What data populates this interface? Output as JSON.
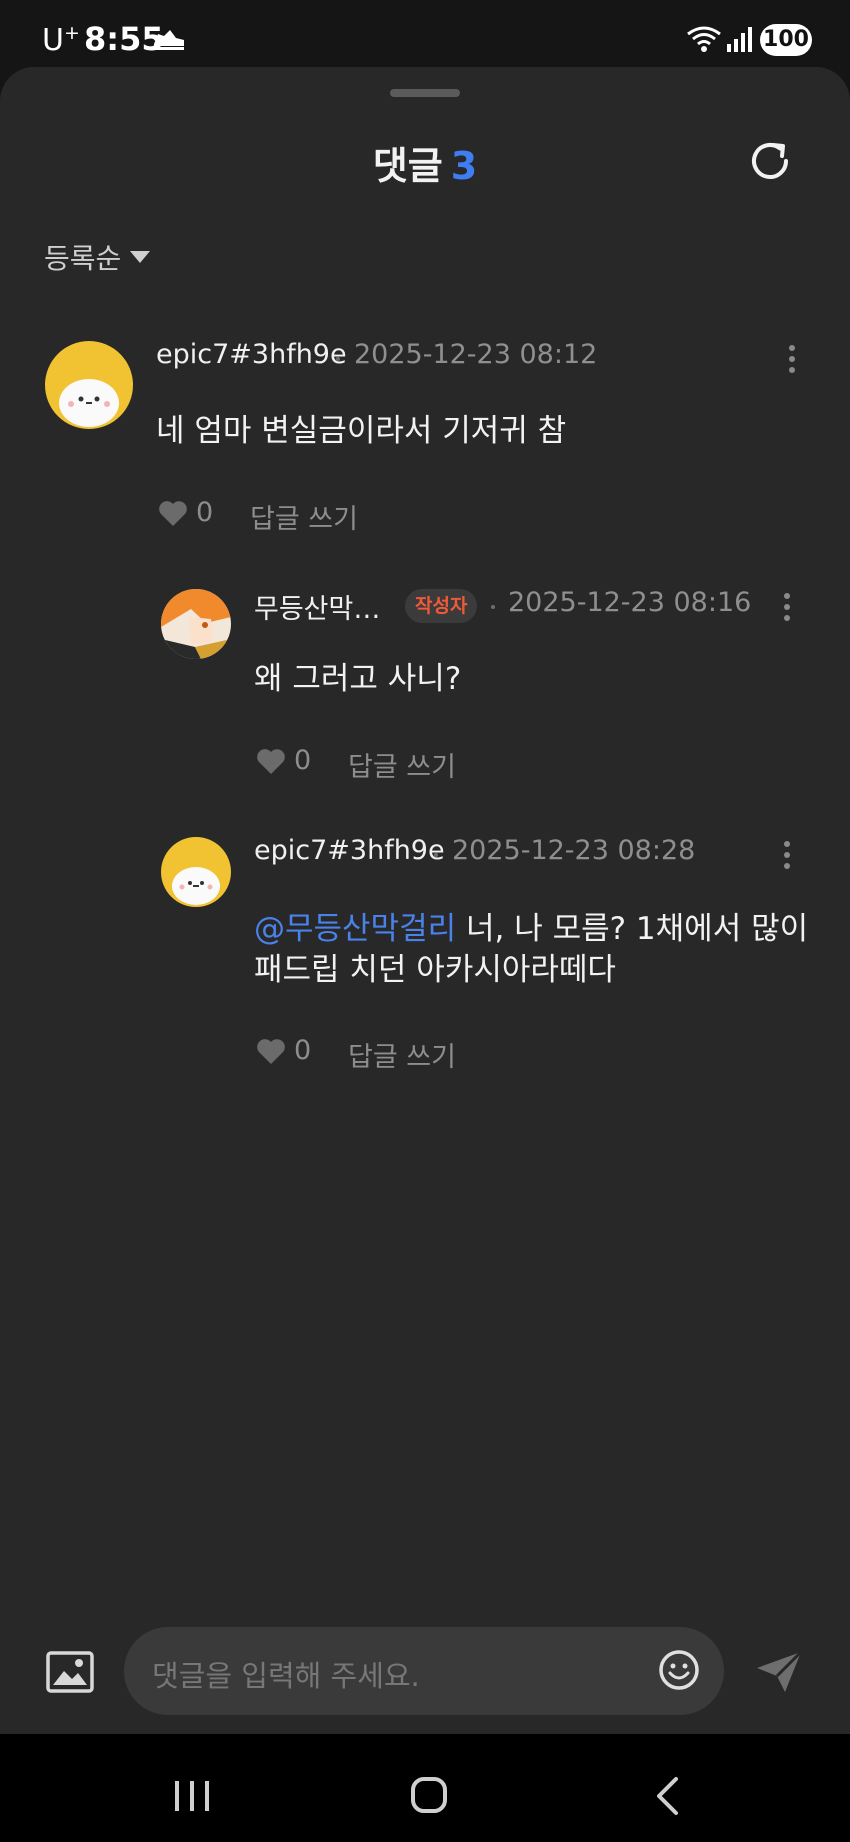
{
  "status_bar": {
    "carrier": "U",
    "carrier_sup": "+",
    "time": "8:55",
    "battery": "100"
  },
  "header": {
    "title": "댓글",
    "count": "3"
  },
  "sort": {
    "label": "등록순"
  },
  "comments": [
    {
      "author": "epic7#3hfh9e",
      "date": "2025-12-23 08:12",
      "body": "네 엄마 변실금이라서 기저귀 참",
      "likes": "0",
      "reply_label": "답글 쓰기"
    },
    {
      "author": "무등산막…",
      "badge": "작성자",
      "date": "2025-12-23 08:16",
      "body": "왜 그러고 사니?",
      "likes": "0",
      "reply_label": "답글 쓰기"
    },
    {
      "author": "epic7#3hfh9e",
      "date": "2025-12-23 08:28",
      "mention": "@무등산막걸리",
      "body_line1": " 너, 나 모름? 1채에서 많이",
      "body_line2": "패드립 치던 아카시아라떼다",
      "likes": "0",
      "reply_label": "답글 쓰기"
    }
  ],
  "input": {
    "placeholder": "댓글을 입력해 주세요."
  },
  "colors": {
    "accent": "#3f7ef2",
    "mention": "#4a82ea",
    "badge_text": "#f05a3a",
    "sheet_bg": "#282828"
  }
}
